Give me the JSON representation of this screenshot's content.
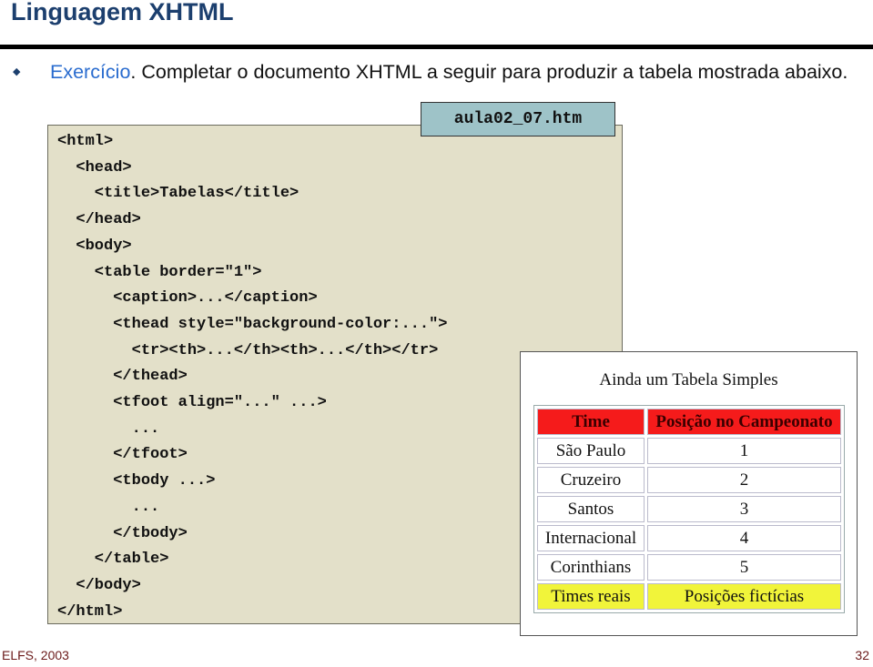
{
  "slide": {
    "title": "Linguagem XHTML",
    "bullet": {
      "accent": "Exercício",
      "text": ". Completar o documento XHTML a seguir para produzir a tabela mostrada abaixo."
    }
  },
  "code": {
    "filename": "aula02_07.htm",
    "lines": [
      "<html>",
      "  <head>",
      "    <title>Tabelas</title>",
      "  </head>",
      "  <body>",
      "    <table border=\"1\">",
      "      <caption>...</caption>",
      "      <thead style=\"background-color:...\">",
      "        <tr><th>...</th><th>...</th></tr>",
      "      </thead>",
      "      <tfoot align=\"...\" ...>",
      "        ...",
      "      </tfoot>",
      "      <tbody ...>",
      "        ...",
      "      </tbody>",
      "    </table>",
      "  </body>",
      "</html>"
    ]
  },
  "preview": {
    "caption": "Ainda um Tabela Simples",
    "header_color": "#f51b1b",
    "footer_color": "#f1f43a",
    "headers": [
      "Time",
      "Posição no Campeonato"
    ],
    "rows": [
      [
        "São Paulo",
        "1"
      ],
      [
        "Cruzeiro",
        "2"
      ],
      [
        "Santos",
        "3"
      ],
      [
        "Internacional",
        "4"
      ],
      [
        "Corinthians",
        "5"
      ]
    ],
    "footer": [
      "Times reais",
      "Posições fictícias"
    ]
  },
  "footer": {
    "left": "ELFS, 2003",
    "page_number": "32"
  }
}
